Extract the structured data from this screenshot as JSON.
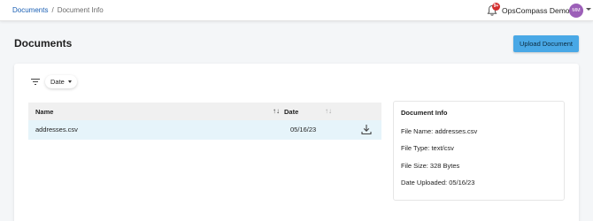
{
  "breadcrumb": {
    "root": "Documents",
    "separator": "/",
    "current": "Document Info"
  },
  "header": {
    "notification_count": "9+",
    "org_name": "OpsCompass Demo",
    "avatar_initials": "MM"
  },
  "page": {
    "title": "Documents",
    "upload_label": "Upload Document"
  },
  "filter": {
    "selected": "Date"
  },
  "table": {
    "columns": {
      "name": "Name",
      "date": "Date"
    },
    "rows": [
      {
        "name": "addresses.csv",
        "date": "05/16/23"
      }
    ]
  },
  "info": {
    "title": "Document Info",
    "file_name": "File Name: addresses.csv",
    "file_type": "File Type: text/csv",
    "file_size": "File Size: 328 Bytes",
    "date_uploaded": "Date Uploaded: 05/16/23"
  },
  "colors": {
    "accent": "#49a8e6",
    "link": "#1a5fb4",
    "avatar": "#9c5fb8",
    "badge": "#d32f2f",
    "row_selected": "#e6f4fa"
  },
  "icons": {
    "filter": "filter-icon",
    "notification": "bell-icon",
    "download": "download-icon",
    "sort": "sort-arrows-icon"
  }
}
